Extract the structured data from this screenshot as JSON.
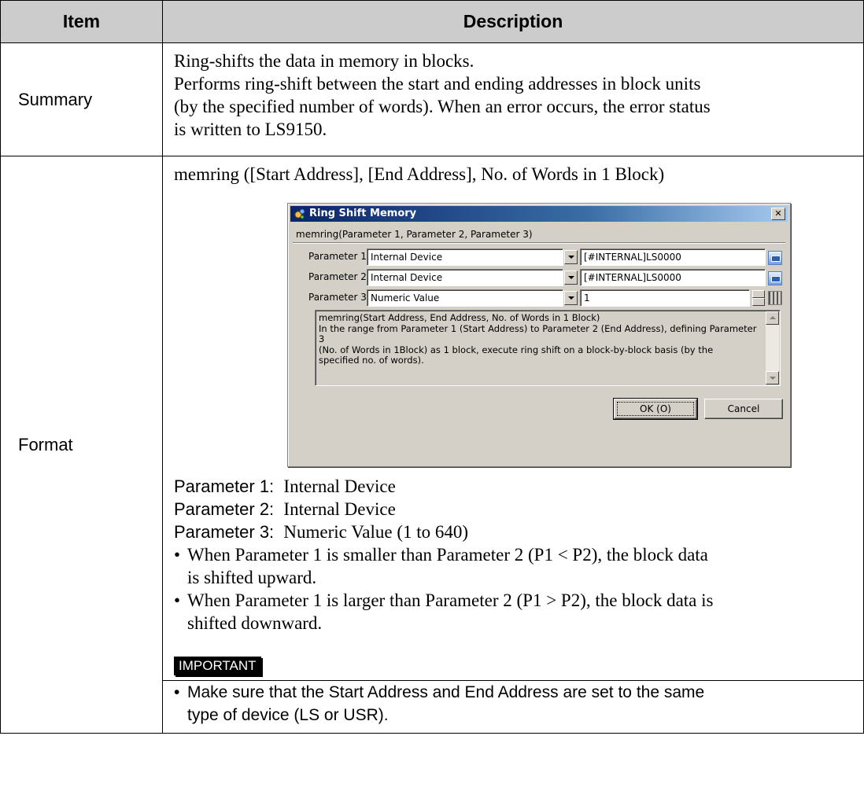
{
  "header": {
    "item": "Item",
    "description": "Description"
  },
  "summary": {
    "label": "Summary",
    "lines": [
      "Ring-shifts the data in memory in blocks.",
      "Performs ring-shift between the start and ending addresses in block units",
      "(by the specified number of words). When an error occurs, the error status",
      "is written to LS9150."
    ]
  },
  "format": {
    "label": "Format",
    "syntax": "memring ([Start Address], [End Address], No. of Words in 1 Block)",
    "dialog": {
      "title": "Ring Shift Memory",
      "signature": "memring(Parameter 1, Parameter 2, Parameter 3)",
      "params": [
        {
          "label": "Parameter 1",
          "type": "Internal Device",
          "value": "[#INTERNAL]LS0000"
        },
        {
          "label": "Parameter 2",
          "type": "Internal Device",
          "value": "[#INTERNAL]LS0000"
        },
        {
          "label": "Parameter 3",
          "type": "Numeric Value",
          "value": "1"
        }
      ],
      "description_lines": [
        "memring(Start Address, End Address, No. of Words in 1 Block)",
        "In the range from Parameter 1 (Start Address) to Parameter 2 (End Address), defining Parameter 3",
        "(No. of Words in 1Block) as 1 block, execute ring shift on a block-by-block basis (by the",
        "specified no. of words)."
      ],
      "ok_label": "OK (O)",
      "cancel_label": "Cancel"
    },
    "param_descriptions": [
      {
        "label": "Parameter 1:",
        "value": "Internal Device"
      },
      {
        "label": "Parameter 2:",
        "value": "Internal Device"
      },
      {
        "label": "Parameter 3:",
        "value": "Numeric Value (1 to 640)"
      }
    ],
    "bullets": [
      [
        "When Parameter 1 is smaller than Parameter 2 (P1 < P2), the block data",
        "is shifted upward."
      ],
      [
        "When Parameter 1 is larger than Parameter 2 (P1 > P2), the block data is",
        "shifted downward."
      ]
    ],
    "important_tag": "IMPORTANT",
    "important_note": [
      "Make sure that the Start Address and End Address are set to the same",
      "type of device (LS or USR)."
    ]
  }
}
